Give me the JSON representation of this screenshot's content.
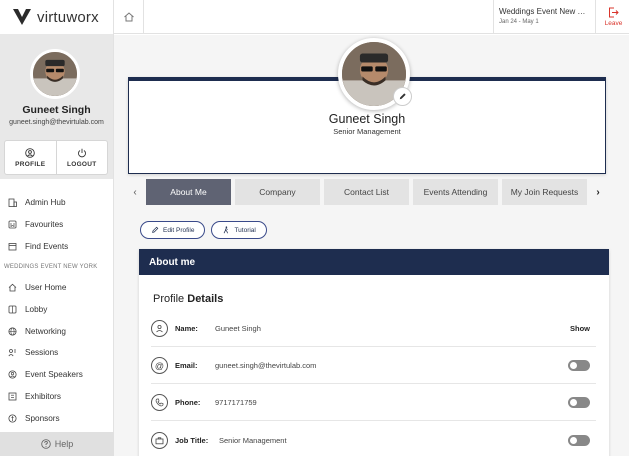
{
  "brand": {
    "name": "virtuworx"
  },
  "sidebar": {
    "user_name": "Guneet Singh",
    "user_email": "guneet.singh@thevirtulab.com",
    "profile_label": "PROFILE",
    "logout_label": "LOGOUT",
    "nav_top": [
      {
        "label": "Admin Hub",
        "icon": "building-icon"
      },
      {
        "label": "Favourites",
        "icon": "bookmark-icon"
      },
      {
        "label": "Find Events",
        "icon": "calendar-icon"
      }
    ],
    "section_label": "WEDDINGS EVENT NEW YORK",
    "nav_event": [
      {
        "label": "User Home",
        "icon": "home-icon"
      },
      {
        "label": "Lobby",
        "icon": "lobby-icon"
      },
      {
        "label": "Networking",
        "icon": "globe-icon"
      },
      {
        "label": "Sessions",
        "icon": "sessions-icon"
      },
      {
        "label": "Event Speakers",
        "icon": "speaker-icon"
      },
      {
        "label": "Exhibitors",
        "icon": "exhibitor-icon"
      },
      {
        "label": "Sponsors",
        "icon": "sponsor-icon"
      }
    ],
    "help_label": "Help"
  },
  "topbar": {
    "event_name": "Weddings Event New York",
    "event_dates": "Jan 24 - May 1",
    "leave_label": "Leave"
  },
  "profile": {
    "name": "Guneet Singh",
    "title": "Senior Management"
  },
  "tabs": [
    {
      "label": "About Me",
      "active": true
    },
    {
      "label": "Company",
      "active": false
    },
    {
      "label": "Contact List",
      "active": false
    },
    {
      "label": "Events Attending",
      "active": false
    },
    {
      "label": "My Join Requests",
      "active": false
    }
  ],
  "actions": {
    "edit_profile": "Edit Profile",
    "tutorial": "Tutorial"
  },
  "about": {
    "header": "About me",
    "section_title_a": "Profile",
    "section_title_b": "Details",
    "show_label": "Show",
    "rows": [
      {
        "label": "Name:",
        "value": "Guneet Singh",
        "icon": "user-icon"
      },
      {
        "label": "Email:",
        "value": "guneet.singh@thevirtulab.com",
        "icon": "at-icon"
      },
      {
        "label": "Phone:",
        "value": "9717171759",
        "icon": "phone-icon"
      },
      {
        "label": "Job Title:",
        "value": "Senior Management",
        "icon": "briefcase-icon"
      }
    ]
  },
  "colors": {
    "navy": "#1e2d4f",
    "active_tab": "#5f6373",
    "leave_red": "#d9342b"
  }
}
